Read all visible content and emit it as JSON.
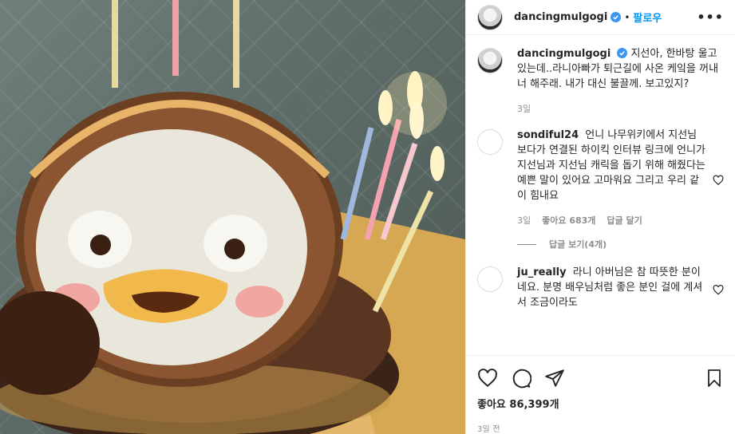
{
  "photo": {
    "alt_hint": ""
  },
  "header": {
    "username": "dancingmulgogi",
    "dot": "•",
    "follow_label": "팔로우",
    "more_label": "•••"
  },
  "caption": {
    "username": "dancingmulgogi",
    "text": "지선아, 한바탕 울고있는데..라니아빠가 퇴근길에 사온 케잌을 꺼내 너 해주래. 내가 대신 불끌께. 보고있지?",
    "time": "3일"
  },
  "comments": [
    {
      "username": "sondiful24",
      "text": "언니 나무위키에서 지선님 보다가 연결된 하이킥 인터뷰 링크에 언니가 지선님과 지선님 캐릭을 돕기 위해 해줬다는 예쁜 말이 있어요 고마워요 그리고 우리 같이 힘내요",
      "time": "3일",
      "likes": "좋아요 683개",
      "reply_label": "답글 달기",
      "view_replies": "답글 보기(4개)"
    },
    {
      "username": "ju_really",
      "text": "라니 아버님은 참 따뜻한 분이네요. 분명 배우님처럼 좋은 분인 걸에 계셔서 조금이라도"
    }
  ],
  "actions": {
    "like_icon": "heart-icon",
    "comment_icon": "comment-icon",
    "share_icon": "share-icon",
    "save_icon": "bookmark-icon"
  },
  "likes_text": "좋아요 86,399개",
  "post_time": "3일 전",
  "colors": {
    "accent": "#0095f6",
    "verified": "#3897f0",
    "muted": "#8e8e8e"
  }
}
